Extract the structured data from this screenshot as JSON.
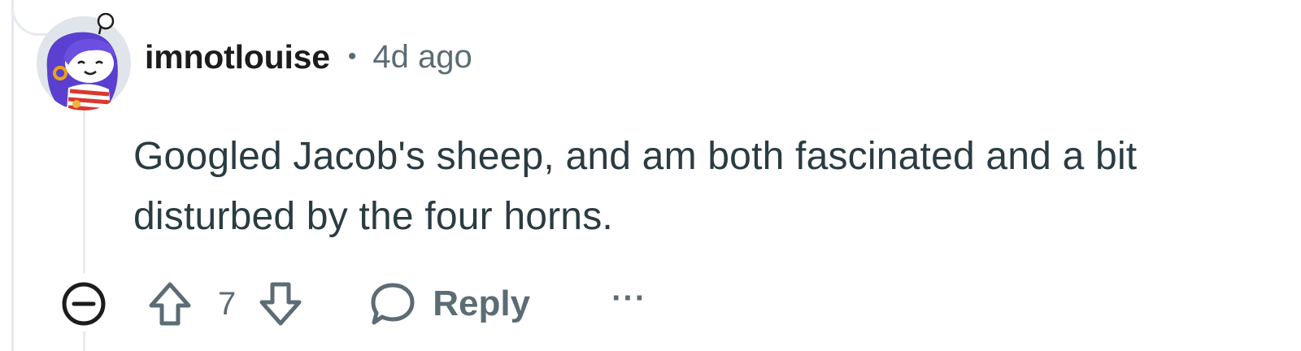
{
  "comment": {
    "author": "imnotlouise",
    "separator": "•",
    "timestamp": "4d ago",
    "body": "Googled Jacob's sheep, and am both fascinated and a bit disturbed by the four horns.",
    "avatar_icon": "snoo-avatar-icon"
  },
  "actions": {
    "collapse_icon": "collapse-icon",
    "upvote_icon": "upvote-icon",
    "vote_count": "7",
    "downvote_icon": "downvote-icon",
    "reply_icon": "comment-bubble-icon",
    "reply_label": "Reply",
    "more_label": "···"
  },
  "colors": {
    "text_primary": "#1c1c1c",
    "text_body": "#2a3c42",
    "text_muted": "#5c6c74",
    "thread_line": "#e5ebee"
  }
}
